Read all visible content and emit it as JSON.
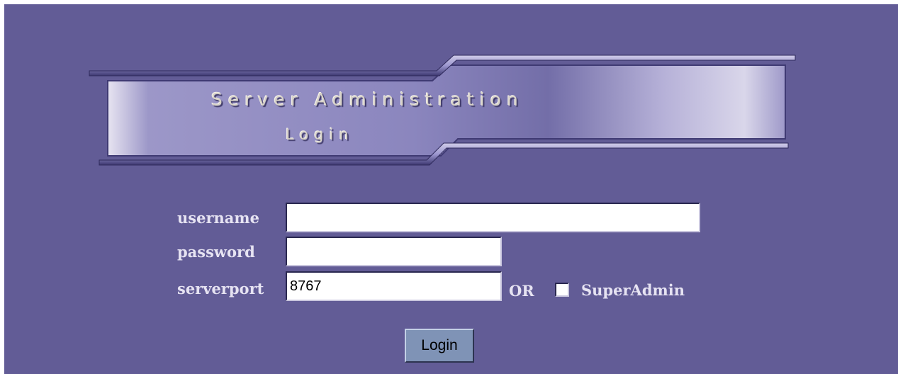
{
  "banner": {
    "title": "Server Administration",
    "subtitle": "Login"
  },
  "form": {
    "username_label": "username",
    "username_value": "",
    "password_label": "password",
    "password_value": "",
    "serverport_label": "serverport",
    "serverport_value": "8767",
    "or_label": "OR",
    "superadmin_label": "SuperAdmin",
    "superadmin_checked": false,
    "login_label": "Login"
  },
  "colors": {
    "background": "#625c96",
    "label_text": "#e6e3f2",
    "button": "#7f93b6",
    "banner_text": "#d8d3c8"
  }
}
